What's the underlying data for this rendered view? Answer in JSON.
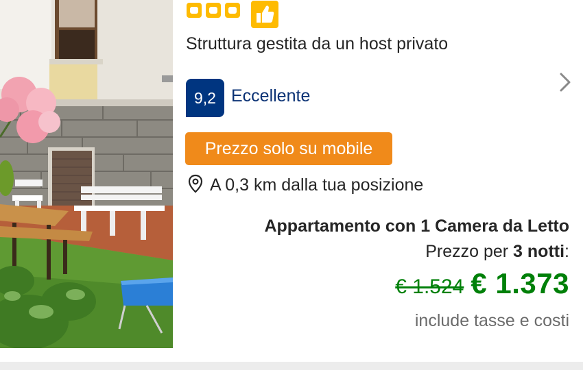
{
  "listing": {
    "star_rating": 3,
    "host_type": "Struttura gestita da un host privato",
    "review_score": "9,2",
    "review_label": "Eccellente",
    "badge_label": "Prezzo solo su mobile",
    "distance": "A 0,3 km dalla tua posizione",
    "room_type": "Appartamento con 1 Camera da Letto",
    "price_for_prefix": "Prezzo per ",
    "price_for_nights": "3 notti",
    "price_for_suffix": ":",
    "original_price": "€ 1.524",
    "current_price": "€ 1.373",
    "taxes_note": "include tasse e costi"
  },
  "icons": {
    "stars": "star-box-icon",
    "thumb": "thumbs-up-icon",
    "chevron": "chevron-right-icon",
    "location": "map-pin-icon"
  },
  "colors": {
    "star_yellow": "#febb02",
    "score_blue": "#003580",
    "badge_orange": "#f08a1a",
    "price_green": "#008009"
  }
}
